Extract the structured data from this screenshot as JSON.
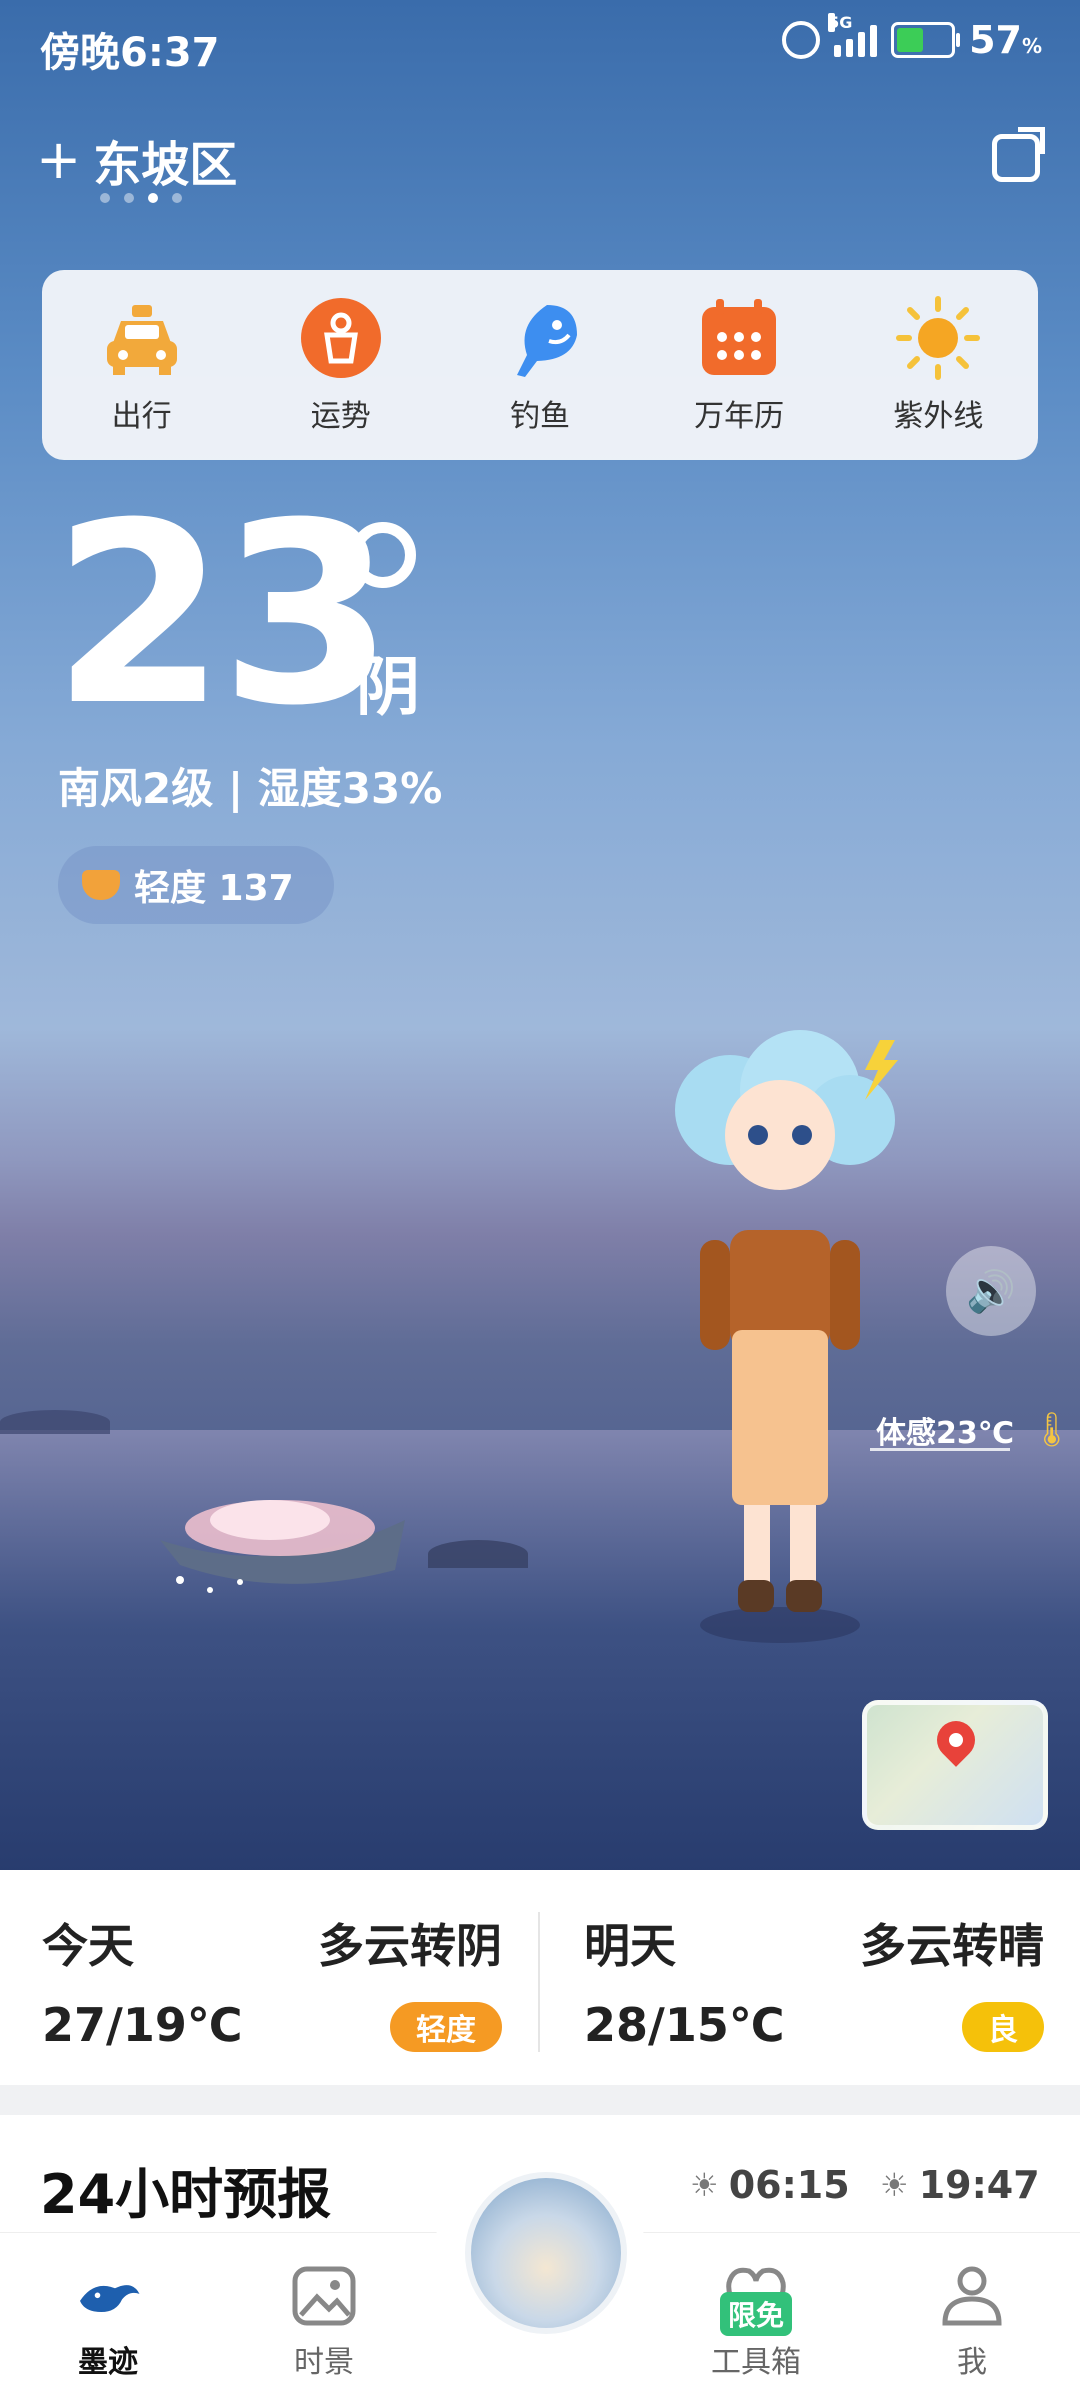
{
  "status_bar": {
    "time": "傍晚6:37",
    "network": "5G",
    "battery": "57",
    "battery_unit": "%"
  },
  "header": {
    "city": "东坡区",
    "add_icon": "plus-icon",
    "share_icon": "share-icon",
    "page_dots": 4,
    "active_dot": 3
  },
  "quick_actions": [
    {
      "label": "出行",
      "icon": "taxi-icon",
      "color": "#f2a93b"
    },
    {
      "label": "运势",
      "icon": "fortune-icon",
      "color": "#f16b2b"
    },
    {
      "label": "钓鱼",
      "icon": "fish-icon",
      "color": "#3d8ef0"
    },
    {
      "label": "万年历",
      "icon": "calendar-icon",
      "color": "#f16b2b"
    },
    {
      "label": "紫外线",
      "icon": "sun-icon",
      "color": "#f5a623"
    }
  ],
  "current": {
    "temperature": "23",
    "condition": "阴",
    "wind_humidity": "南风2级 | 湿度33%",
    "aqi_text": "轻度 137",
    "feels_like": "体感23℃"
  },
  "forecast": [
    {
      "day": "今天",
      "weather": "多云转阴",
      "range": "27/19℃",
      "aqi": "轻度",
      "aqi_color": "#f59a23"
    },
    {
      "day": "明天",
      "weather": "多云转晴",
      "range": "28/15℃",
      "aqi": "良",
      "aqi_color": "#f5c10a"
    }
  ],
  "hourly": {
    "title": "24小时预报",
    "sunrise": "06:15",
    "sunset": "19:47"
  },
  "tabs": [
    {
      "label": "墨迹",
      "icon": "moji-logo-icon",
      "active": true
    },
    {
      "label": "时景",
      "icon": "photo-icon",
      "active": false
    },
    {
      "label": "工具箱",
      "icon": "toolbox-icon",
      "active": false,
      "badge": "限免"
    },
    {
      "label": "我",
      "icon": "profile-icon",
      "active": false
    }
  ]
}
